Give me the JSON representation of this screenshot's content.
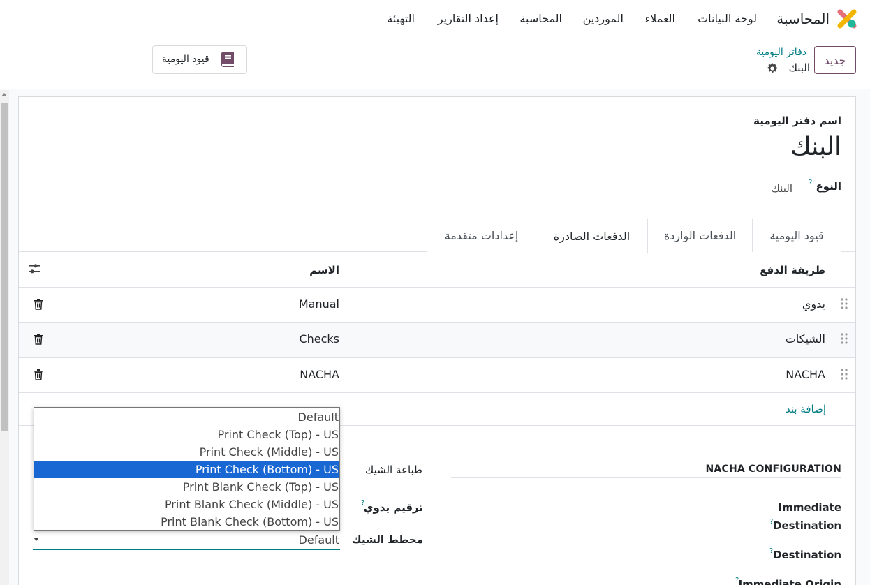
{
  "topbar": {
    "app_name": "المحاسبة",
    "nav": [
      "لوحة البيانات",
      "العملاء",
      "الموردين",
      "المحاسبة",
      "إعداد التقارير",
      "التهيئة"
    ]
  },
  "control_panel": {
    "new_label": "جديد",
    "breadcrumb_parent": "دفاتر اليومية",
    "breadcrumb_current": "البنك",
    "smart_button_label": "قيود اليومية"
  },
  "form": {
    "name_label": "اسم دفتر اليومية",
    "journal_name": "البنك",
    "type_label": "النوع",
    "type_value": "البنك",
    "help_mark": "?"
  },
  "tabs": [
    {
      "label": "قيود اليومية",
      "active": false
    },
    {
      "label": "الدفعات الواردة",
      "active": false
    },
    {
      "label": "الدفعات الصادرة",
      "active": true
    },
    {
      "label": "إعدادات متقدمة",
      "active": false
    }
  ],
  "table": {
    "col_method": "طريقة الدفع",
    "col_name": "الاسم",
    "rows": [
      {
        "method": "يدوي",
        "name": "Manual"
      },
      {
        "method": "الشيكات",
        "name": "Checks"
      },
      {
        "method": "NACHA",
        "name": "NACHA"
      }
    ],
    "add_line": "إضافة بند"
  },
  "nacha": {
    "title": "NACHA CONFIGURATION",
    "immediate_destination_1": "Immediate",
    "immediate_destination_2": "Destination",
    "destination": "Destination",
    "partial_label": "Immediate Origin"
  },
  "check": {
    "print_label": "طباعة الشيك",
    "manual_numbering_label": "ترقيم يدوي",
    "layout_label": "مخطط الشيك",
    "layout_value": "Default",
    "options": [
      "Default",
      "Print Check (Top) - US",
      "Print Check (Middle) - US",
      "Print Check (Bottom) - US",
      "Print Blank Check (Top) - US",
      "Print Blank Check (Middle) - US",
      "Print Blank Check (Bottom) - US"
    ],
    "highlighted_option": "Print Check (Bottom) - US"
  },
  "colors": {
    "brand": "#714b67",
    "link": "#017e84",
    "highlight": "#1967d2"
  },
  "icons": [
    "app-logo-icon",
    "gear-icon",
    "book-icon",
    "settings-sliders-icon",
    "drag-handle-icon",
    "trash-icon",
    "chevron-down-icon"
  ]
}
